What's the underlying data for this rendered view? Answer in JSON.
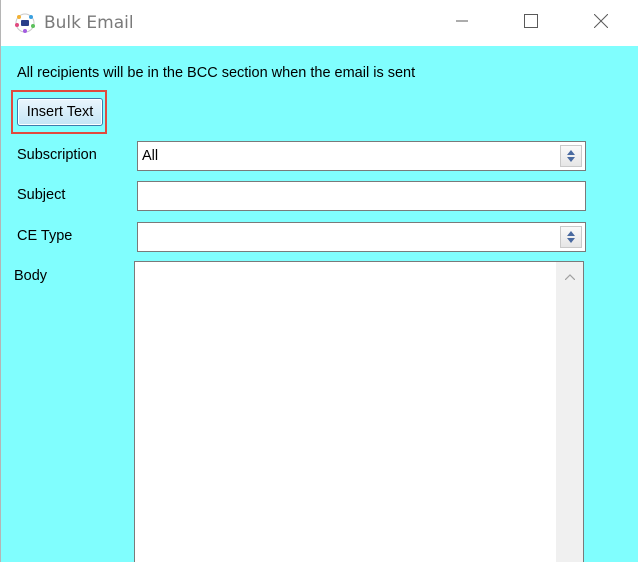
{
  "window": {
    "title": "Bulk Email",
    "app_icon": "app-logo-icon",
    "controls": [
      "minimize-icon",
      "maximize-icon",
      "close-icon"
    ]
  },
  "notice": "All recipients will be in the BCC section when the email is sent",
  "toolbar": {
    "insert_text_label": "Insert Text"
  },
  "form": {
    "subscription_label": "Subscription",
    "subscription_value": "All",
    "subject_label": "Subject",
    "subject_value": "",
    "ce_type_label": "CE Type",
    "ce_type_value": "",
    "body_label": "Body",
    "body_value": ""
  },
  "colors": {
    "background": "#80fefe",
    "highlight": "#e04a3f"
  }
}
